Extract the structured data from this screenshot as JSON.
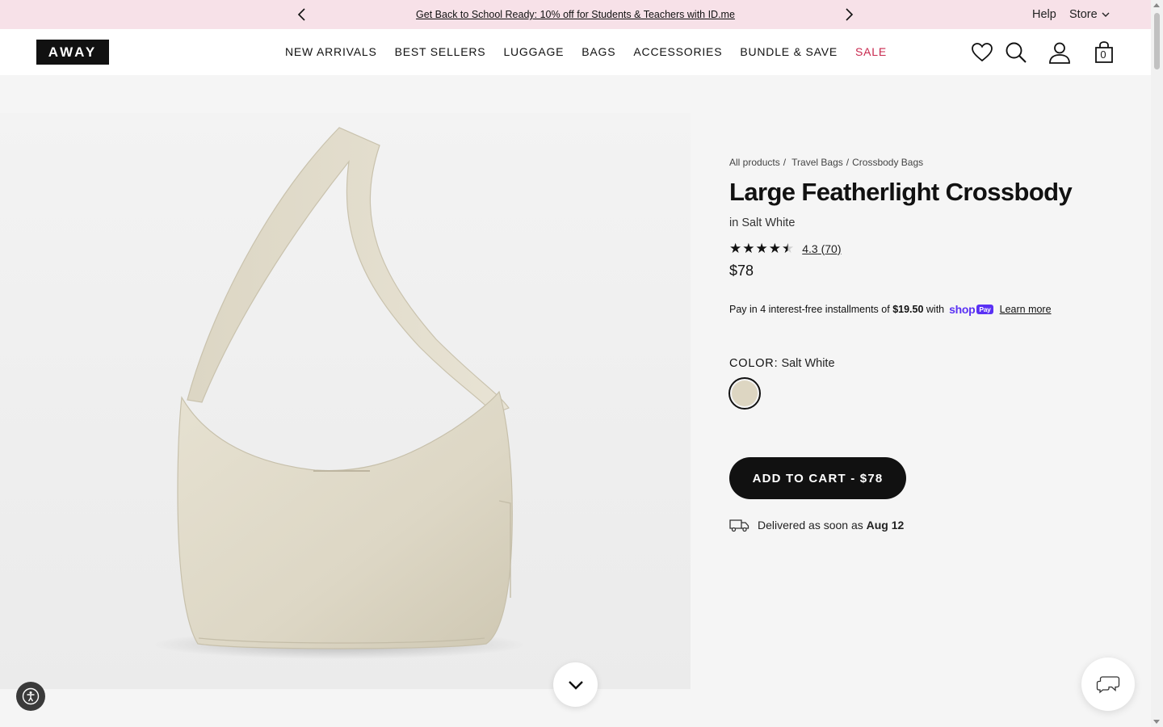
{
  "promo": {
    "message": "Get Back to School Ready: 10% off for Students & Teachers with ID.me",
    "help": "Help",
    "store": "Store"
  },
  "header": {
    "logo": "AWAY",
    "nav": [
      "NEW ARRIVALS",
      "BEST SELLERS",
      "LUGGAGE",
      "BAGS",
      "ACCESSORIES",
      "BUNDLE & SAVE",
      "SALE"
    ],
    "cart_count": "0"
  },
  "breadcrumb": [
    "All products",
    "Travel Bags",
    "Crossbody Bags"
  ],
  "product": {
    "title": "Large Featherlight Crossbody",
    "variant": "in Salt White",
    "rating": "4.3",
    "rating_value": 4.3,
    "review_count": "(70)",
    "price": "$78",
    "installments_prefix": "Pay in 4 interest-free installments of",
    "installment_amount": "$19.50",
    "installments_with": "with",
    "shop_logo": "shop",
    "shop_pay_badge": "Pay",
    "learn_more": "Learn more",
    "color_key": "COLOR:",
    "color_value": "Salt White",
    "swatch_color": "#ddd6c2",
    "add_to_cart": "ADD TO CART - $78",
    "delivery_prefix": "Delivered as soon as",
    "delivery_date": "Aug 12"
  },
  "colors": {
    "promo_bg": "#f7e1e8",
    "sale": "#c8284e",
    "shop_pay": "#5a31f4",
    "button": "#111111"
  }
}
